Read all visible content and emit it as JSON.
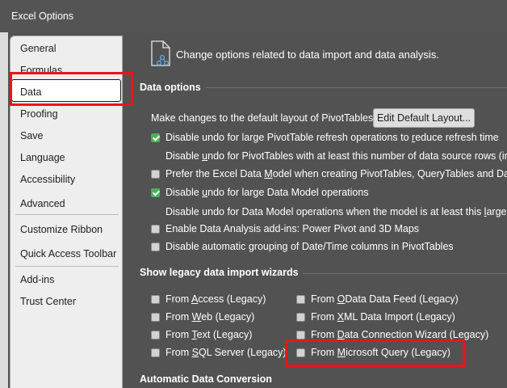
{
  "window": {
    "title": "Excel Options"
  },
  "sidebar": {
    "items": [
      {
        "label": "General"
      },
      {
        "label": "Formulas"
      },
      {
        "label": "Data",
        "selected": true
      },
      {
        "label": "Proofing"
      },
      {
        "label": "Save"
      },
      {
        "label": "Language"
      },
      {
        "label": "Accessibility"
      },
      {
        "label": "Advanced"
      },
      {
        "label": "Customize Ribbon"
      },
      {
        "label": "Quick Access Toolbar"
      },
      {
        "label": "Add-ins"
      },
      {
        "label": "Trust Center"
      }
    ]
  },
  "main": {
    "header": "Change options related to data import and data analysis.",
    "data_options": {
      "title": "Data options",
      "default_layout_label": "Make changes to the default layout of PivotTables:",
      "edit_default_layout_button": "Edit Default Layout...",
      "options": [
        {
          "pre": "Disable undo for large PivotTable refresh operations to ",
          "u": "r",
          "post": "educe refresh time",
          "checked": true
        },
        {
          "pre": "Disable ",
          "u": "u",
          "post": "ndo for PivotTables with at least this number of data source rows (in thousands):",
          "checkbox": false
        },
        {
          "pre": "Prefer the Excel Data ",
          "u": "M",
          "post": "odel when creating PivotTables, QueryTables and Data Connections",
          "checked": false
        },
        {
          "pre": "Disable ",
          "u": "u",
          "post": "ndo for large Data Model operations",
          "checked": true
        },
        {
          "pre": "Disable undo for Data Model operations when the model is at least this ",
          "u": "l",
          "post": "arge (in MB):",
          "checkbox": false
        },
        {
          "pre": "Enable Data Analysis add-ins: Power Pivot and 3D Maps",
          "u": "",
          "post": "",
          "checked": false
        },
        {
          "pre": "Disable automatic grouping of Date/Time columns in PivotTables",
          "u": "",
          "post": "",
          "checked": false
        }
      ]
    },
    "legacy": {
      "title": "Show legacy data import wizards",
      "left": [
        {
          "pre": "From ",
          "u": "A",
          "post": "ccess (Legacy)"
        },
        {
          "pre": "From ",
          "u": "W",
          "post": "eb (Legacy)"
        },
        {
          "pre": "From ",
          "u": "T",
          "post": "ext (Legacy)"
        },
        {
          "pre": "From ",
          "u": "S",
          "post": "QL Server (Legacy)"
        }
      ],
      "right": [
        {
          "pre": "From ",
          "u": "O",
          "post": "Data Data Feed (Legacy)"
        },
        {
          "pre": "From ",
          "u": "X",
          "post": "ML Data Import (Legacy)"
        },
        {
          "pre": "From ",
          "u": "D",
          "post": "ata Connection Wizard (Legacy)"
        },
        {
          "pre": "From ",
          "u": "M",
          "post": "icrosoft Query (Legacy)"
        }
      ]
    },
    "conversion": {
      "title": "Automatic Data Conversion"
    }
  },
  "colors": {
    "dialog_bg": "#525252",
    "nav_bg": "#eeeeee",
    "check_green": "#4fae5a",
    "annotation_red": "#e8141c"
  }
}
